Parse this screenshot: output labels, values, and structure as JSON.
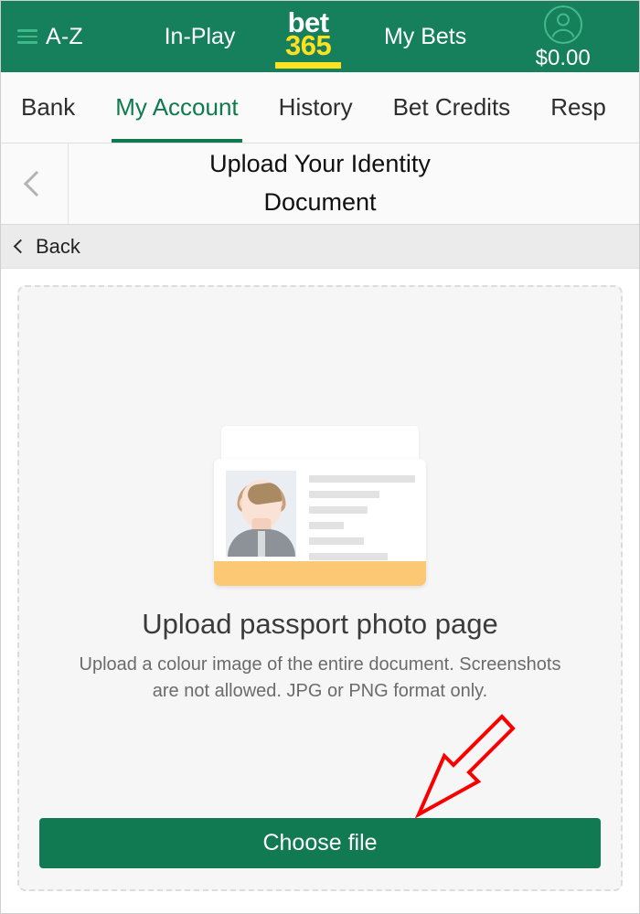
{
  "topbar": {
    "menu_icon": "hamburger-icon",
    "az_label": "A-Z",
    "inplay_label": "In-Play",
    "logo_top": "bet",
    "logo_bottom": "365",
    "mybets_label": "My Bets",
    "account_icon": "user-avatar-icon",
    "balance": "$0.00",
    "bg_color": "#16805c",
    "accent_yellow": "#ffe121"
  },
  "tabs": [
    {
      "label": "Bank",
      "active": false
    },
    {
      "label": "My Account",
      "active": true
    },
    {
      "label": "History",
      "active": false
    },
    {
      "label": "Bet Credits",
      "active": false
    },
    {
      "label": "Resp",
      "active": false
    }
  ],
  "subheader": {
    "back_icon": "chevron-left-icon",
    "title_line1": "Upload Your Identity",
    "title_line2": "Document"
  },
  "backbar": {
    "icon": "chevron-left-icon",
    "label": "Back"
  },
  "upload": {
    "illustration": "passport-document-icon",
    "heading": "Upload passport photo page",
    "description": "Upload a colour image of the entire document. Screenshots are not allowed. JPG or PNG format only.",
    "button_label": "Choose file",
    "button_color": "#127a52",
    "stripe_color": "#fcc873",
    "doc_lines": [
      100,
      66,
      55,
      33,
      52,
      74
    ]
  },
  "annotation": {
    "arrow": "red-arrow-pointing-to-choose-file",
    "color": "#f90000"
  }
}
